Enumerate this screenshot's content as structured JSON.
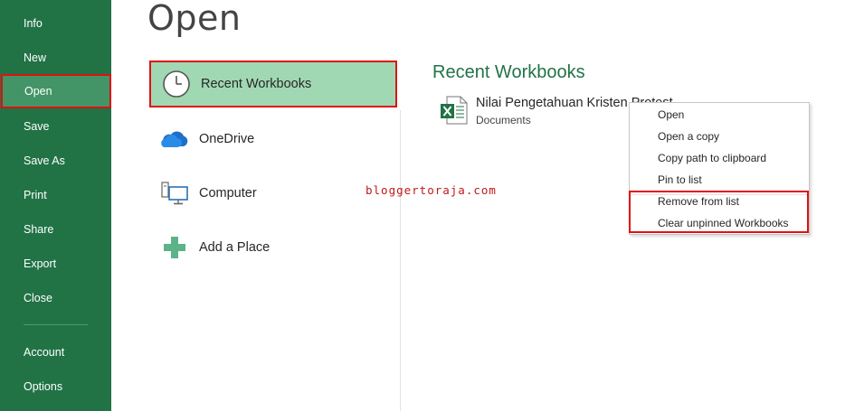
{
  "sidebar": {
    "items": [
      {
        "label": "Info"
      },
      {
        "label": "New"
      },
      {
        "label": "Open"
      },
      {
        "label": "Save"
      },
      {
        "label": "Save As"
      },
      {
        "label": "Print"
      },
      {
        "label": "Share"
      },
      {
        "label": "Export"
      },
      {
        "label": "Close"
      },
      {
        "label": "Account"
      },
      {
        "label": "Options"
      }
    ],
    "active": "Open"
  },
  "page": {
    "title": "Open"
  },
  "locations": [
    {
      "label": "Recent Workbooks",
      "icon": "clock-icon"
    },
    {
      "label": "OneDrive",
      "icon": "cloud-icon"
    },
    {
      "label": "Computer",
      "icon": "computer-icon"
    },
    {
      "label": "Add a Place",
      "icon": "plus-icon"
    }
  ],
  "recent": {
    "heading": "Recent Workbooks",
    "files": [
      {
        "name": "Nilai Pengetahuan Kristen Protest",
        "location": "Documents",
        "icon": "excel-file-icon"
      }
    ]
  },
  "watermark": "bloggertoraja.com",
  "context_menu": {
    "items": [
      {
        "label": "Open"
      },
      {
        "label": "Open a copy"
      },
      {
        "label": "Copy path to clipboard"
      },
      {
        "label": "Pin to list"
      },
      {
        "label": "Remove from list"
      },
      {
        "label": "Clear unpinned Workbooks"
      }
    ]
  },
  "colors": {
    "sidebar": "#217346",
    "sidebar_active": "#439467",
    "selection": "#a0d8b3",
    "highlight_box": "#e01010",
    "accent_text": "#217346"
  }
}
